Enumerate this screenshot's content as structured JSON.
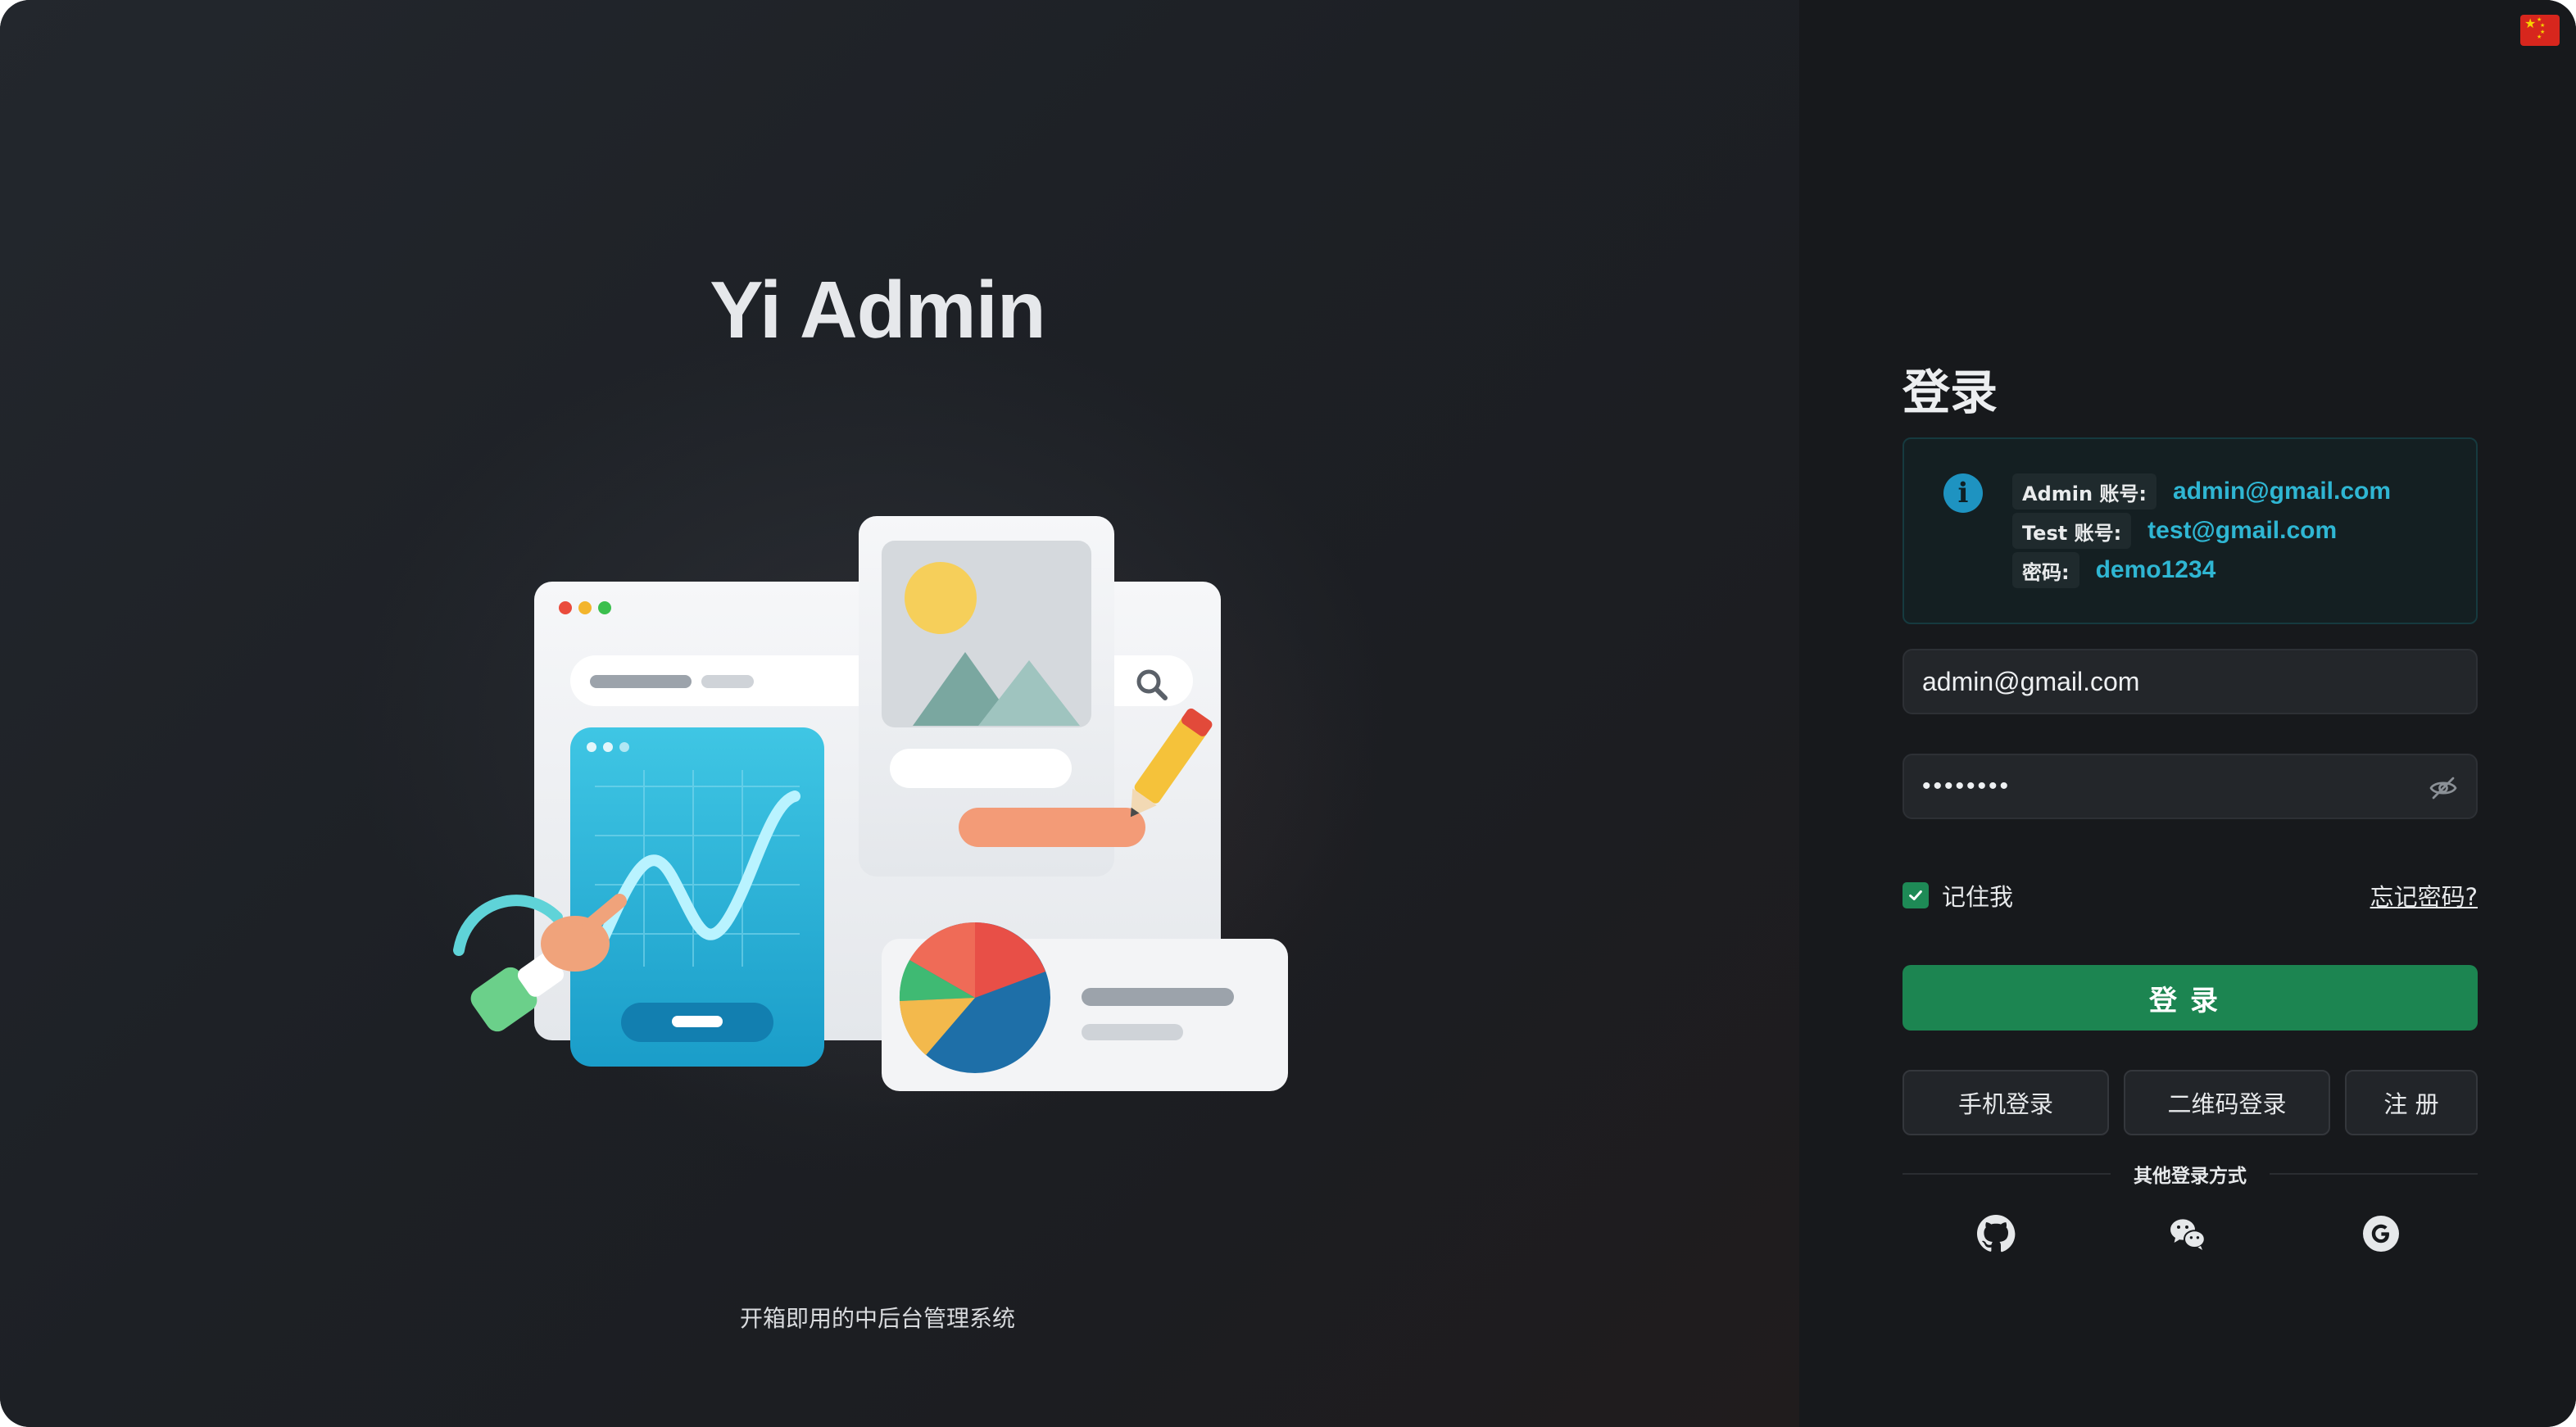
{
  "hero": {
    "title": "Yi Admin",
    "subtitle": "开箱即用的中后台管理系统"
  },
  "language": {
    "current_flag": "china-flag-icon"
  },
  "login": {
    "title": "登录",
    "alert": {
      "icon": "info-icon",
      "rows": [
        {
          "label": "Admin 账号:",
          "value": "admin@gmail.com"
        },
        {
          "label": "Test 账号:",
          "value": "test@gmail.com"
        },
        {
          "label": "密码:",
          "value": "demo1234"
        }
      ]
    },
    "email_value": "admin@gmail.com",
    "password_masked": "••••••••",
    "password_toggle_icon": "eye-off-icon",
    "remember_label": "记住我",
    "remember_checked": true,
    "forgot_label": "忘记密码?",
    "submit_label": "登录",
    "alt_buttons": {
      "phone": "手机登录",
      "qrcode": "二维码登录",
      "register": "注 册"
    },
    "other_methods_label": "其他登录方式",
    "social_icons": [
      "github-icon",
      "wechat-icon",
      "google-icon"
    ]
  },
  "colors": {
    "accent_green": "#1c8551",
    "link_cyan": "#2fb6d3",
    "info_blue": "#1e93c1",
    "panel_bg": "#17191c"
  }
}
